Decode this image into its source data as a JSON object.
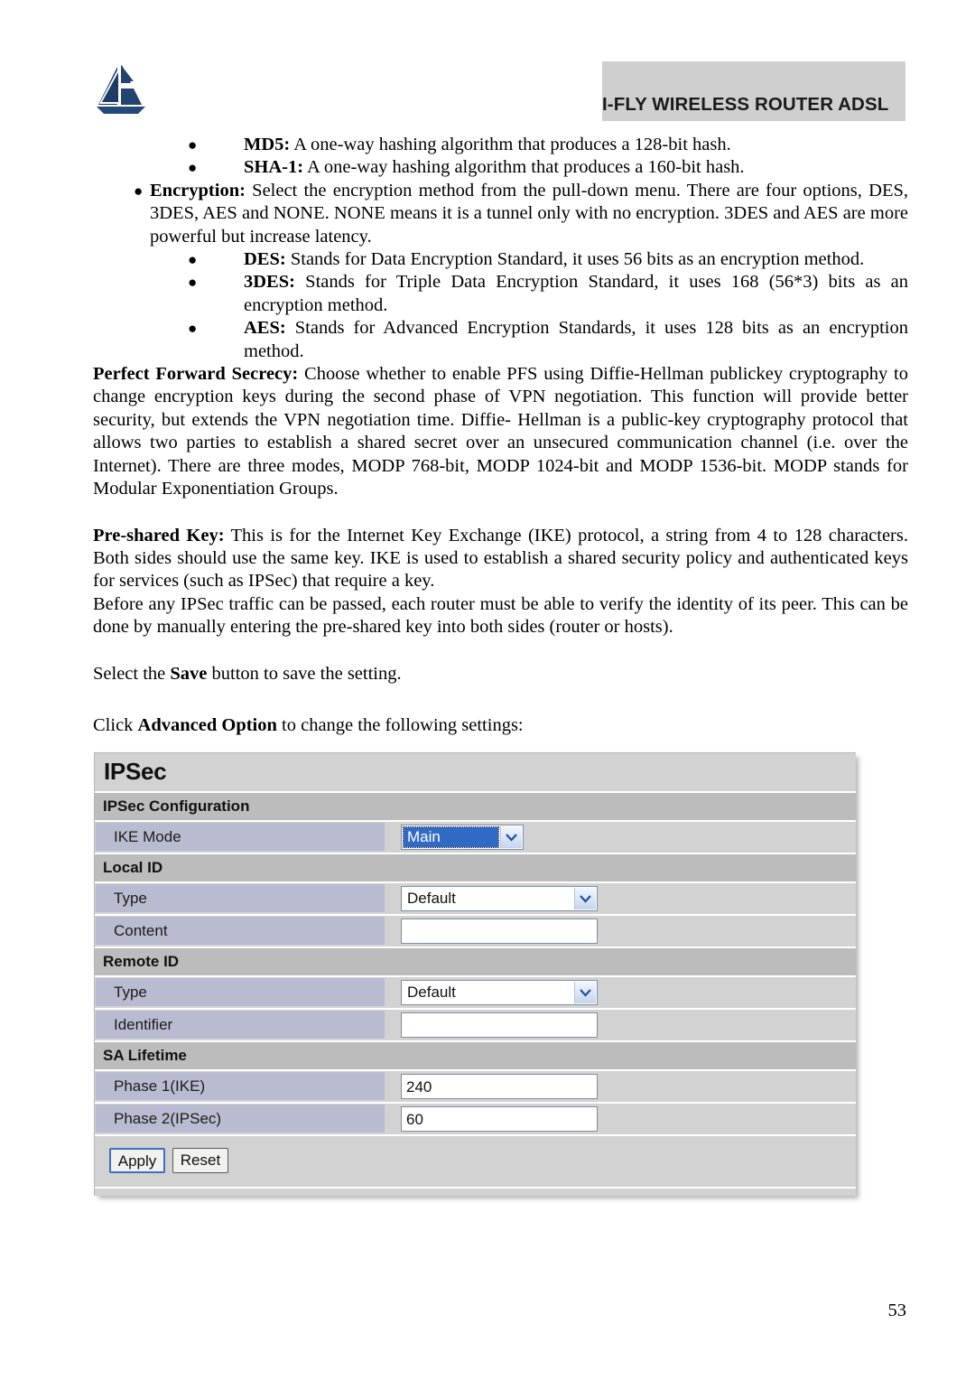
{
  "header": {
    "banner_title": "I-FLY WIRELESS ROUTER ADSL",
    "logo_name": "atlantis-land-logo"
  },
  "content": {
    "bullets_hash": [
      {
        "term": "MD5:",
        "text": " A one-way hashing algorithm that produces a 128-bit hash."
      },
      {
        "term": "SHA-1:",
        "text": " A one-way hashing algorithm that produces a 160-bit hash."
      }
    ],
    "encryption_bullet": {
      "term": "Encryption:",
      "text": " Select the encryption method from the pull-down menu. There are four options, DES, 3DES, AES and NONE. NONE means it is a tunnel only with no encryption. 3DES and AES are more powerful but increase latency."
    },
    "bullets_encryption": [
      {
        "term": "DES:",
        "text": " Stands for Data Encryption Standard, it uses 56 bits as an encryption method."
      },
      {
        "term": "3DES:",
        "text": " Stands for Triple Data Encryption Standard, it uses 168 (56*3) bits as an encryption method."
      },
      {
        "term": "AES:",
        "text": " Stands for Advanced Encryption Standards, it uses 128 bits as an encryption method."
      }
    ],
    "pfs_paragraph": {
      "term": "Perfect Forward Secrecy:",
      "text": " Choose whether to enable PFS using Diffie-Hellman publickey cryptography to change encryption keys during the second phase of VPN negotiation. This function will provide better security, but extends the VPN negotiation time. Diffie- Hellman is a public-key cryptography protocol that allows two parties to establish a shared secret over an unsecured communication channel (i.e. over the Internet). There are three modes, MODP 768-bit, MODP 1024-bit and MODP 1536-bit. MODP stands for Modular Exponentiation Groups."
    },
    "psk_paragraph": {
      "term": "Pre-shared Key:",
      "text": " This is for the Internet Key Exchange (IKE) protocol, a string from 4 to 128 characters. Both sides should use the same key. IKE is used to establish a shared security policy and authenticated keys for services (such as IPSec) that require a key."
    },
    "psk_paragraph2": "Before any IPSec traffic can be passed, each router must be able to verify the identity of its peer. This can be done by manually entering the pre-shared key into both sides (router or hosts).",
    "save_line": {
      "pre": "Select the ",
      "term": "Save",
      "post": " button to save the setting."
    },
    "advanced_line": {
      "pre": "Click ",
      "term": "Advanced Option",
      "post": " to change the following settings:"
    }
  },
  "ipsec_panel": {
    "title": "IPSec",
    "sections": [
      {
        "heading": "IPSec Configuration"
      },
      {
        "heading": "Local ID"
      },
      {
        "heading": "Remote ID"
      },
      {
        "heading": "SA Lifetime"
      }
    ],
    "fields": {
      "ike_mode": {
        "label": "IKE Mode",
        "value": "Main",
        "control": "select",
        "focused": true
      },
      "local_type": {
        "label": "Type",
        "value": "Default",
        "control": "select"
      },
      "local_content": {
        "label": "Content",
        "value": "",
        "control": "text"
      },
      "remote_type": {
        "label": "Type",
        "value": "Default",
        "control": "select"
      },
      "remote_identifier": {
        "label": "Identifier",
        "value": "",
        "control": "text"
      },
      "phase1": {
        "label": "Phase 1(IKE)",
        "value": "240",
        "control": "text"
      },
      "phase2": {
        "label": "Phase 2(IPSec)",
        "value": "60",
        "control": "text"
      }
    },
    "buttons": {
      "apply": "Apply",
      "reset": "Reset"
    },
    "colors": {
      "section_header_bg": "#bcbcbc",
      "row_bg": "#d2d2d2",
      "label_bg": "#b9bcd0",
      "select_highlight": "#316ac5",
      "focus_ring": "#3c6fc4"
    }
  },
  "footer": {
    "page_number": "53"
  }
}
